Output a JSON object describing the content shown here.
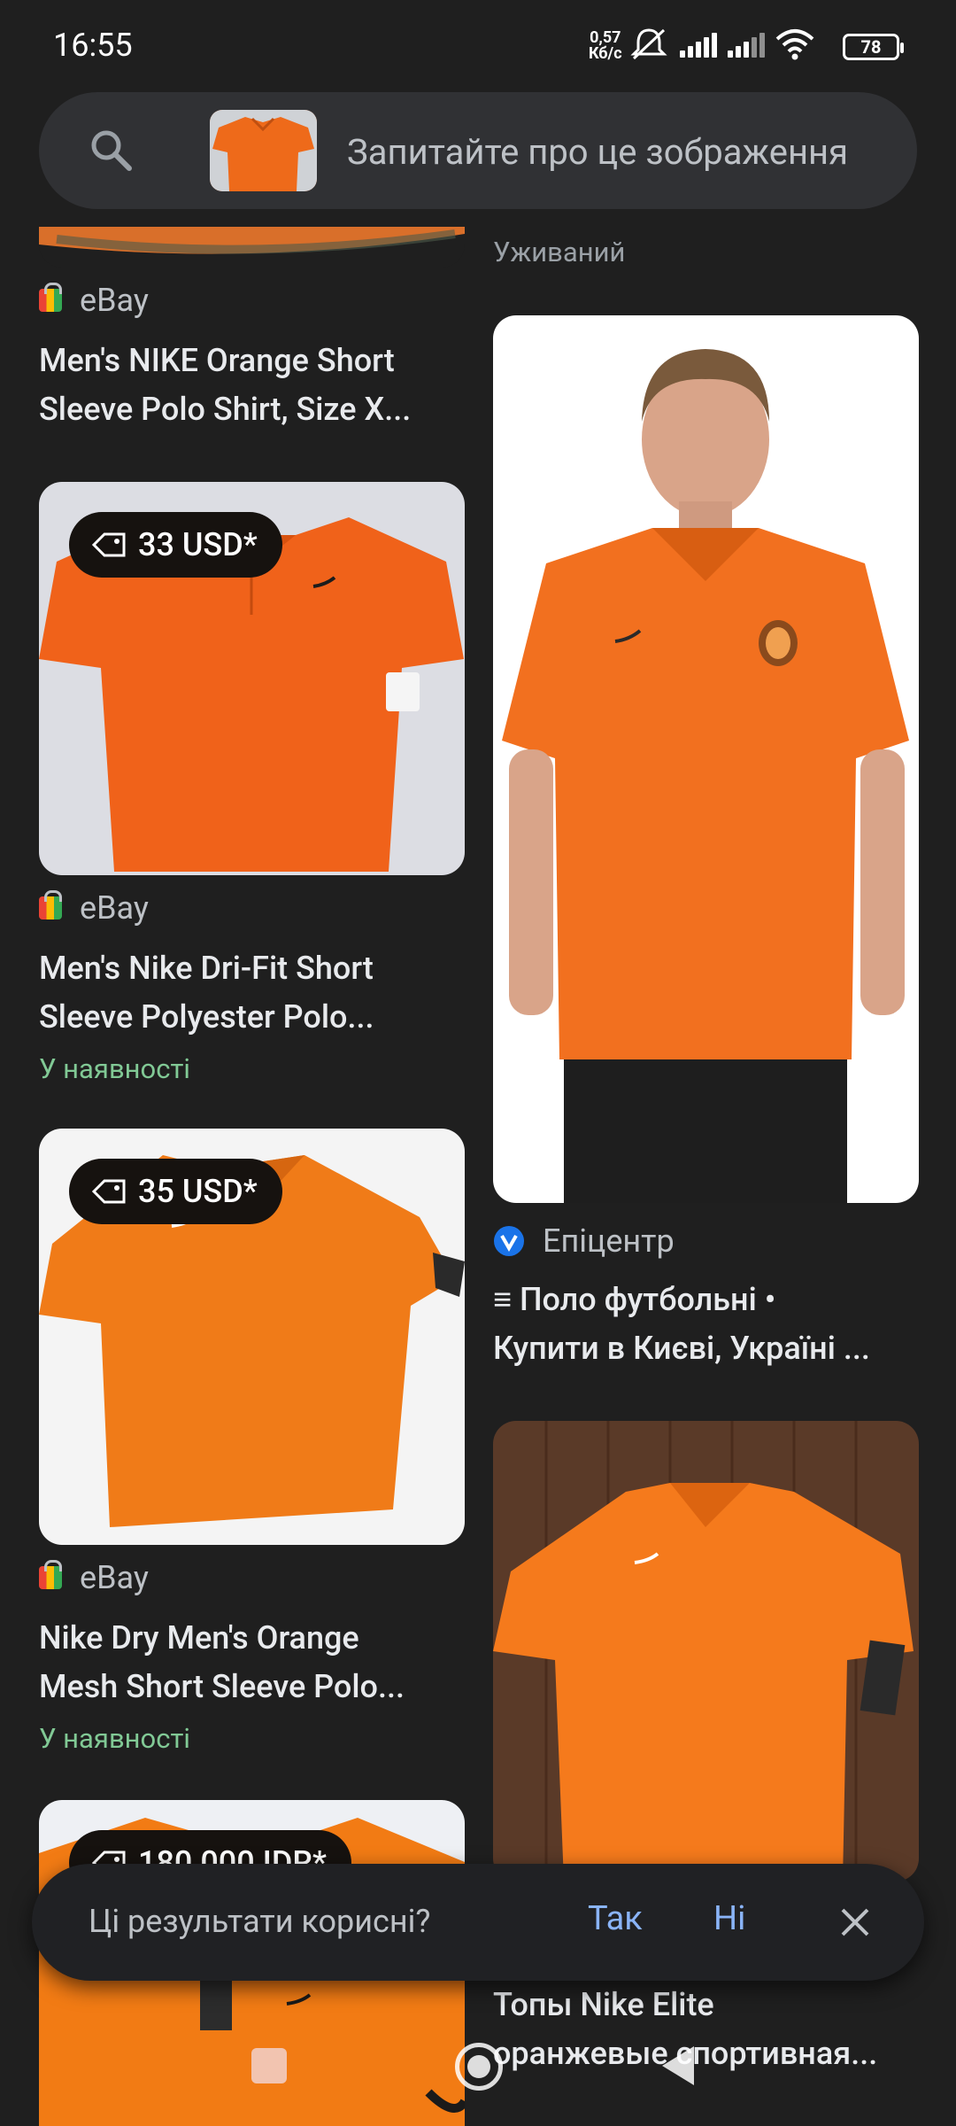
{
  "status_bar": {
    "time": "16:55",
    "speed_value": "0,57",
    "speed_unit": "Кб/с",
    "battery": "78"
  },
  "search": {
    "placeholder": "Запитайте про це зображення"
  },
  "results": {
    "left": [
      {
        "source": "eBay",
        "title_line1": "Men's NIKE Orange Short",
        "title_line2": "Sleeve Polo Shirt, Size X..."
      },
      {
        "price": "33 USD*",
        "source": "eBay",
        "title_line1": "Men's Nike Dri-Fit Short",
        "title_line2": "Sleeve Polyester Polo...",
        "availability": "У наявності"
      },
      {
        "price": "35 USD*",
        "source": "eBay",
        "title_line1": "Nike Dry Men's Orange",
        "title_line2": "Mesh Short Sleeve Polo...",
        "availability": "У наявності"
      },
      {
        "price": "180 000 IDR*"
      }
    ],
    "right": [
      {
        "condition": "Уживаний"
      },
      {
        "source": "Епіцентр",
        "title_line1": "≡ Поло футбольні •",
        "title_line2": "Купити в Києві, Україні ..."
      },
      {
        "title_line1": "Топы Nike Elite",
        "title_line2": "оранжевые спортивная..."
      }
    ]
  },
  "feedback": {
    "question": "Ці результати корисні?",
    "yes": "Так",
    "no": "Ні"
  },
  "colors": {
    "background": "#1f1f1f",
    "accent_blue": "#8ab4f8",
    "in_stock_green": "#81c995",
    "shirt_orange": "#f26d1d"
  }
}
